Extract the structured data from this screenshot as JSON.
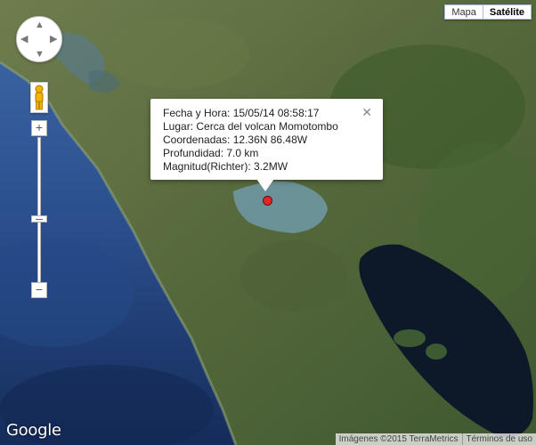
{
  "map_type": {
    "map_label": "Mapa",
    "satellite_label": "Satélite"
  },
  "pan_control": {
    "up": "▲",
    "down": "▼",
    "left": "◀",
    "right": "▶"
  },
  "zoom": {
    "in_label": "+",
    "out_label": "−"
  },
  "info_window": {
    "lines": [
      "Fecha y Hora: 15/05/14 08:58:17",
      "Lugar: Cerca del volcan Momotombo",
      "Coordenadas: 12.36N 86.48W",
      "Profundidad: 7.0 km",
      "Magnitud(Richter): 3.2MW"
    ],
    "close_label": "✕"
  },
  "footer": {
    "logo": "Google",
    "imagery": "Imágenes ©2015 TerraMetrics",
    "terms": "Términos de uso"
  },
  "colors": {
    "marker": "#e0262b",
    "ocean": "#1f3a6e",
    "land": "#4c5d33",
    "lake": "#0e1a2e"
  }
}
